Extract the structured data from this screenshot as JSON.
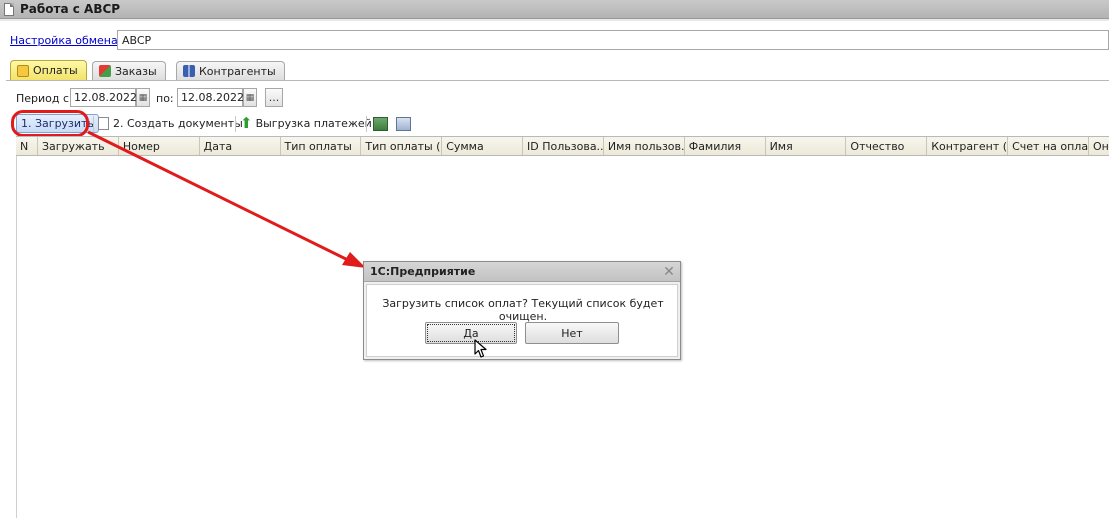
{
  "window": {
    "title": "Работа с ABCP"
  },
  "exchange": {
    "link_label": "Настройка обмена",
    "value": "ABCP"
  },
  "tabs": [
    {
      "label": "Оплаты",
      "icon": "payments-icon",
      "active": true
    },
    {
      "label": "Заказы",
      "icon": "orders-icon",
      "active": false
    },
    {
      "label": "Контрагенты",
      "icon": "contractors-icon",
      "active": false
    }
  ],
  "period": {
    "from_label": "Период с:",
    "from_value": "12.08.2022",
    "to_label": "по:",
    "to_value": "12.08.2022",
    "more_label": "..."
  },
  "toolbar": {
    "load_label": "1. Загрузить",
    "create_docs_label": "2. Создать документы",
    "export_payments_label": "Выгрузка платежей"
  },
  "table": {
    "columns": [
      "N",
      "Загружать",
      "Номер",
      "Дата",
      "Тип оплаты",
      "Тип оплаты (...",
      "Сумма",
      "ID Пользова...",
      "Имя пользов...",
      "Фамилия",
      "Имя",
      "Отчество",
      "Контрагент (...",
      "Счет на опла...",
      "Он"
    ]
  },
  "dialog": {
    "title": "1С:Предприятие",
    "message": "Загрузить список оплат? Текущий список будет очищен.",
    "yes_label": "Да",
    "no_label": "Нет"
  },
  "colors": {
    "accent_red": "#e11b1b",
    "active_tab": "#f2e36a",
    "link": "#0000cc"
  }
}
